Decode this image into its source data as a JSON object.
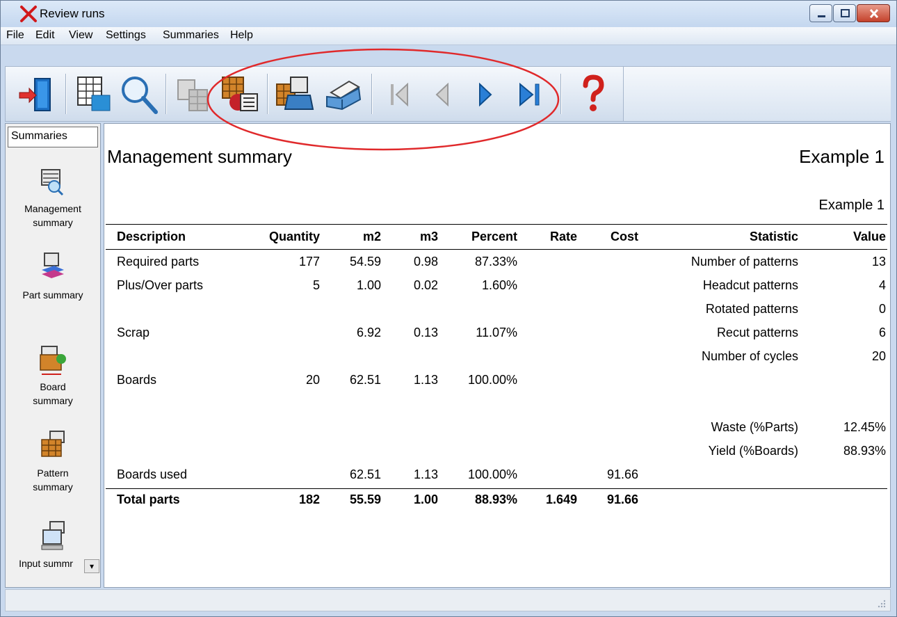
{
  "window": {
    "title": "Review runs",
    "controls": {
      "minimize": "minimize",
      "maximize": "maximize",
      "close": "close"
    }
  },
  "menu": [
    "File",
    "Edit",
    "View",
    "Settings",
    "Summaries",
    "Help"
  ],
  "toolbar": {
    "buttons": [
      {
        "icon": "exit-door-icon",
        "label": "Exit"
      },
      {
        "icon": "report-layout-icon",
        "label": "Report layout"
      },
      {
        "icon": "magnifier-icon",
        "label": "Preview"
      },
      {
        "icon": "copy-disabled-icon",
        "label": "Copy"
      },
      {
        "icon": "export-report-icon",
        "label": "Export"
      },
      {
        "icon": "print-batch-icon",
        "label": "Print batch"
      },
      {
        "icon": "printer-icon",
        "label": "Print"
      },
      {
        "icon": "first-page-icon",
        "label": "First"
      },
      {
        "icon": "previous-page-icon",
        "label": "Previous"
      },
      {
        "icon": "next-page-icon",
        "label": "Next"
      },
      {
        "icon": "last-page-icon",
        "label": "Last"
      },
      {
        "icon": "help-question-icon",
        "label": "Help"
      }
    ]
  },
  "sidebar": {
    "tab_label": "Summaries",
    "items": [
      {
        "label": "Management summary",
        "icon": "management-summary-icon"
      },
      {
        "label": "Part summary",
        "icon": "part-summary-icon"
      },
      {
        "label": "Board summary",
        "icon": "board-summary-icon"
      },
      {
        "label": "Pattern summary",
        "icon": "pattern-summary-icon"
      },
      {
        "label": "Input summr",
        "icon": "input-summary-icon"
      }
    ],
    "scroll_glyph": "▾"
  },
  "report": {
    "title": "Management summary",
    "run_name": "Example 1",
    "run_subtitle": "Example 1",
    "headers": {
      "description": "Description",
      "quantity": "Quantity",
      "m2": "m2",
      "m3": "m3",
      "percent": "Percent",
      "rate": "Rate",
      "cost": "Cost",
      "statistic": "Statistic",
      "value": "Value"
    },
    "rows": [
      {
        "description": "Required parts",
        "quantity": "177",
        "m2": "54.59",
        "m3": "0.98",
        "percent": "87.33%",
        "rate": "",
        "cost": "",
        "statistic": "Number of patterns",
        "value": "13"
      },
      {
        "description": "Plus/Over parts",
        "quantity": "5",
        "m2": "1.00",
        "m3": "0.02",
        "percent": "1.60%",
        "rate": "",
        "cost": "",
        "statistic": "Headcut patterns",
        "value": "4"
      },
      {
        "description": "",
        "quantity": "",
        "m2": "",
        "m3": "",
        "percent": "",
        "rate": "",
        "cost": "",
        "statistic": "Rotated patterns",
        "value": "0"
      },
      {
        "description": "Scrap",
        "quantity": "",
        "m2": "6.92",
        "m3": "0.13",
        "percent": "11.07%",
        "rate": "",
        "cost": "",
        "statistic": "Recut patterns",
        "value": "6"
      },
      {
        "description": "",
        "quantity": "",
        "m2": "",
        "m3": "",
        "percent": "",
        "rate": "",
        "cost": "",
        "statistic": "Number of cycles",
        "value": "20"
      },
      {
        "description": "Boards",
        "quantity": "20",
        "m2": "62.51",
        "m3": "1.13",
        "percent": "100.00%",
        "rate": "",
        "cost": "",
        "statistic": "",
        "value": ""
      },
      {
        "description": "",
        "quantity": "",
        "m2": "",
        "m3": "",
        "percent": "",
        "rate": "",
        "cost": "",
        "statistic": "",
        "value": ""
      },
      {
        "description": "",
        "quantity": "",
        "m2": "",
        "m3": "",
        "percent": "",
        "rate": "",
        "cost": "",
        "statistic": "Waste (%Parts)",
        "value": "12.45%"
      },
      {
        "description": "",
        "quantity": "",
        "m2": "",
        "m3": "",
        "percent": "",
        "rate": "",
        "cost": "",
        "statistic": "Yield (%Boards)",
        "value": "88.93%"
      },
      {
        "description": "Boards used",
        "quantity": "",
        "m2": "62.51",
        "m3": "1.13",
        "percent": "100.00%",
        "rate": "",
        "cost": "91.66",
        "statistic": "",
        "value": ""
      }
    ],
    "total": {
      "description": "Total parts",
      "quantity": "182",
      "m2": "55.59",
      "m3": "1.00",
      "percent": "88.93%",
      "rate": "1.649",
      "cost": "91.66"
    }
  },
  "colors": {
    "annotation_ellipse": "#e0292b",
    "window_frame": "#c9d9ee",
    "nav_arrow": "#2a7fd6"
  }
}
